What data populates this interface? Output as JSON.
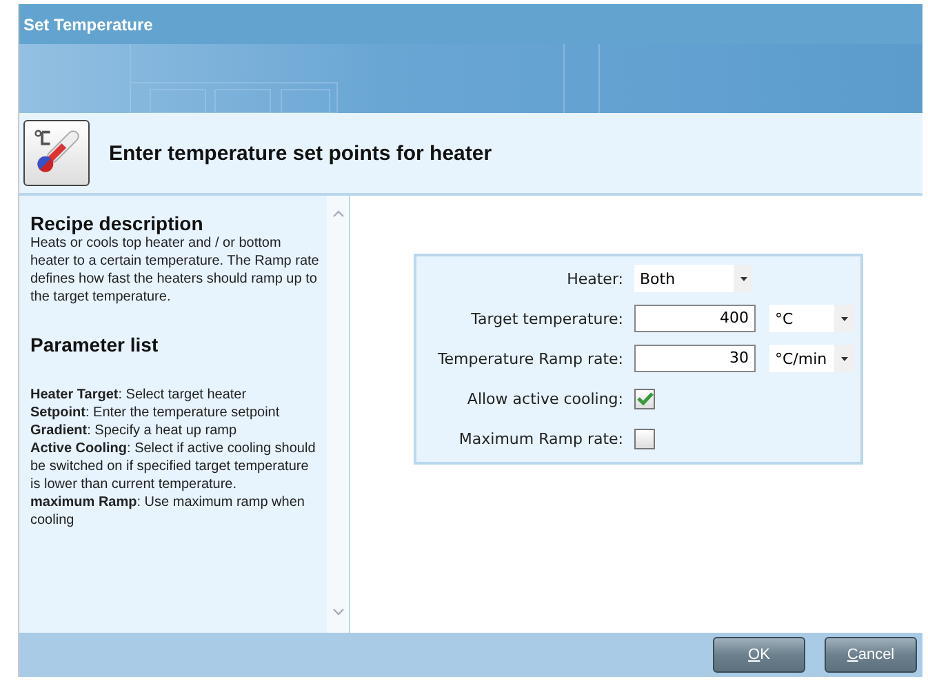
{
  "window": {
    "title": "Set Temperature"
  },
  "header": {
    "title": "Enter temperature set points for heater"
  },
  "description": {
    "title": "Recipe description",
    "text": "Heats or cools top heater and / or bottom heater to a certain temperature. The Ramp rate defines how fast the heaters should ramp up to the target temperature.",
    "parameter_title": "Parameter list",
    "parameters": [
      "**Heater Target**: Select target heater",
      "**Setpoint**: Enter the temperature setpoint",
      "**Gradient**: Specify a heat up ramp",
      "**Active Cooling**: Select if active cooling should be switched on if specified target temperature is lower than current temperature.",
      "**maximum Ramp**: Use maximum ramp when cooling"
    ]
  },
  "form": [
    {
      "kind": "select",
      "label": "Heater:",
      "value": "Both"
    },
    {
      "kind": "number",
      "label": "Target temperature:",
      "value": "400",
      "unit": "°C"
    },
    {
      "kind": "number",
      "label": "Temperature Ramp rate:",
      "value": "30",
      "unit": "°C/min"
    },
    {
      "kind": "checkbox",
      "label": "Allow active cooling:",
      "checked": true
    },
    {
      "kind": "checkbox",
      "label": "Maximum Ramp rate:",
      "checked": false
    }
  ],
  "buttons": [
    "OK",
    "Cancel"
  ]
}
